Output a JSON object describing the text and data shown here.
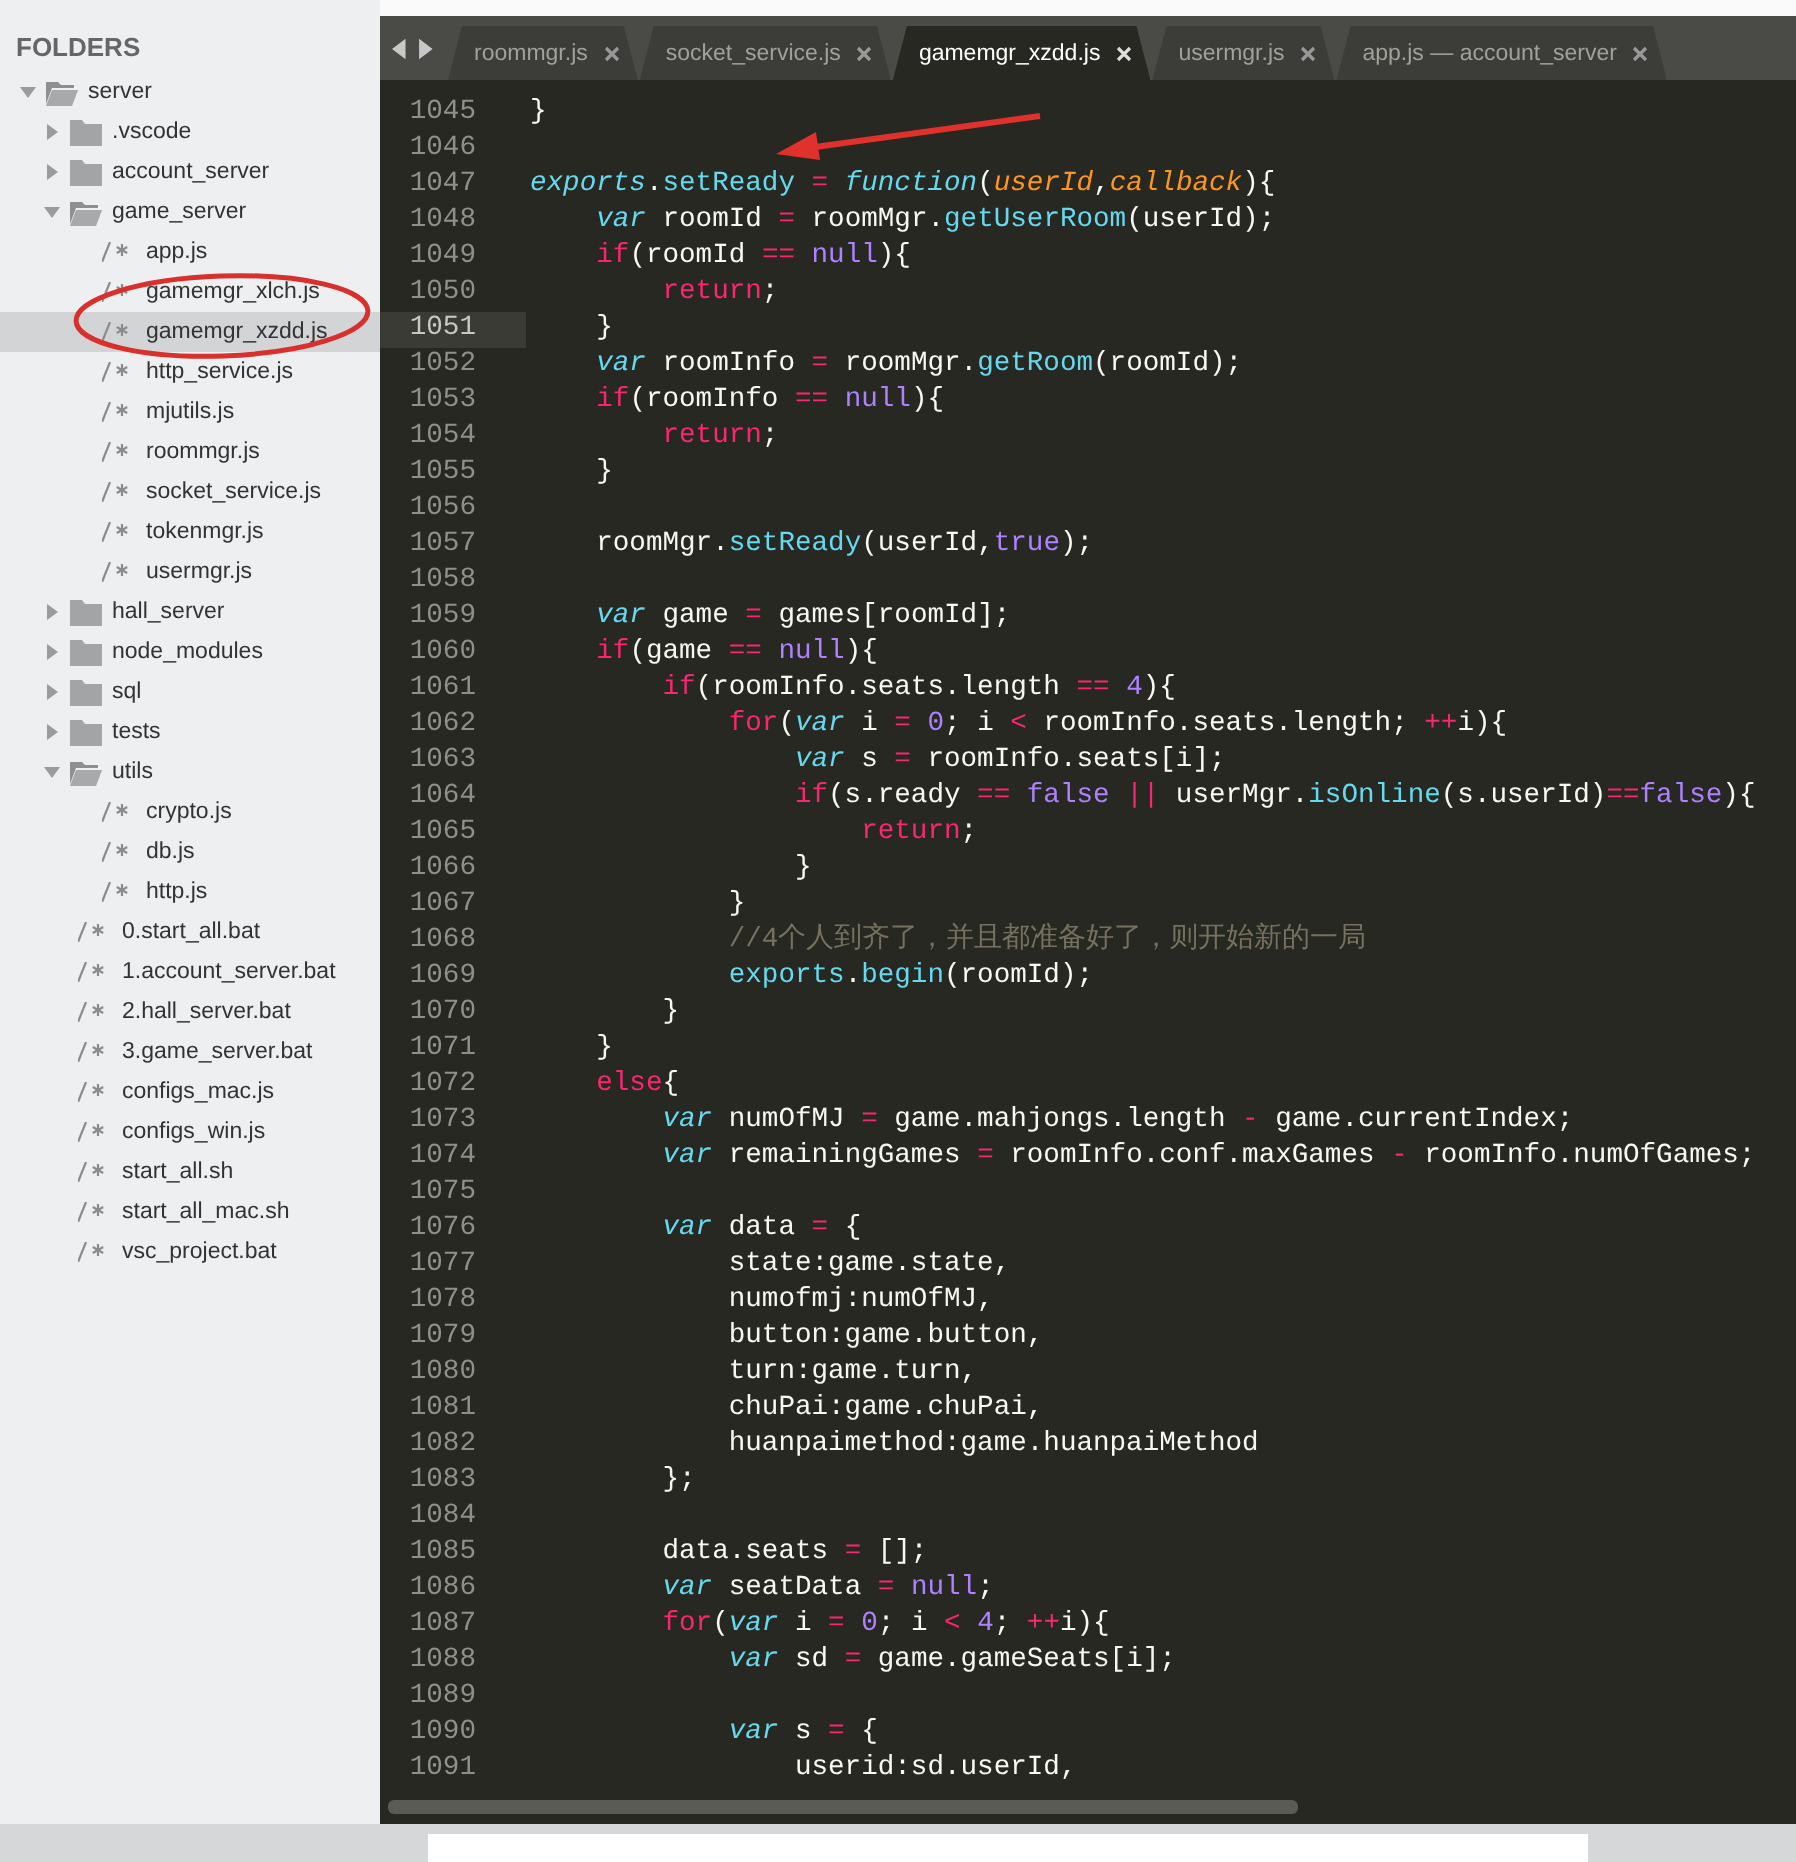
{
  "sidebar": {
    "title": "FOLDERS",
    "tree": [
      {
        "kind": "folder",
        "label": "server",
        "expanded": true,
        "selected": false,
        "children": [
          {
            "kind": "folder",
            "label": ".vscode",
            "expanded": false,
            "selected": false
          },
          {
            "kind": "folder",
            "label": "account_server",
            "expanded": false,
            "selected": false
          },
          {
            "kind": "folder",
            "label": "game_server",
            "expanded": true,
            "selected": false,
            "children": [
              {
                "kind": "file",
                "label": "app.js",
                "selected": false
              },
              {
                "kind": "file",
                "label": "gamemgr_xlch.js",
                "selected": false
              },
              {
                "kind": "file",
                "label": "gamemgr_xzdd.js",
                "selected": true
              },
              {
                "kind": "file",
                "label": "http_service.js",
                "selected": false
              },
              {
                "kind": "file",
                "label": "mjutils.js",
                "selected": false
              },
              {
                "kind": "file",
                "label": "roommgr.js",
                "selected": false
              },
              {
                "kind": "file",
                "label": "socket_service.js",
                "selected": false
              },
              {
                "kind": "file",
                "label": "tokenmgr.js",
                "selected": false
              },
              {
                "kind": "file",
                "label": "usermgr.js",
                "selected": false
              }
            ]
          },
          {
            "kind": "folder",
            "label": "hall_server",
            "expanded": false,
            "selected": false
          },
          {
            "kind": "folder",
            "label": "node_modules",
            "expanded": false,
            "selected": false
          },
          {
            "kind": "folder",
            "label": "sql",
            "expanded": false,
            "selected": false
          },
          {
            "kind": "folder",
            "label": "tests",
            "expanded": false,
            "selected": false
          },
          {
            "kind": "folder",
            "label": "utils",
            "expanded": true,
            "selected": false,
            "children": [
              {
                "kind": "file",
                "label": "crypto.js",
                "selected": false
              },
              {
                "kind": "file",
                "label": "db.js",
                "selected": false
              },
              {
                "kind": "file",
                "label": "http.js",
                "selected": false
              }
            ]
          },
          {
            "kind": "file",
            "label": "0.start_all.bat",
            "selected": false
          },
          {
            "kind": "file",
            "label": "1.account_server.bat",
            "selected": false
          },
          {
            "kind": "file",
            "label": "2.hall_server.bat",
            "selected": false
          },
          {
            "kind": "file",
            "label": "3.game_server.bat",
            "selected": false
          },
          {
            "kind": "file",
            "label": "configs_mac.js",
            "selected": false
          },
          {
            "kind": "file",
            "label": "configs_win.js",
            "selected": false
          },
          {
            "kind": "file",
            "label": "start_all.sh",
            "selected": false
          },
          {
            "kind": "file",
            "label": "start_all_mac.sh",
            "selected": false
          },
          {
            "kind": "file",
            "label": "vsc_project.bat",
            "selected": false
          }
        ]
      }
    ]
  },
  "tabs": [
    {
      "label": "roommgr.js",
      "selected": false
    },
    {
      "label": "socket_service.js",
      "selected": false
    },
    {
      "label": "gamemgr_xzdd.js",
      "selected": true
    },
    {
      "label": "usermgr.js",
      "selected": false
    },
    {
      "label": "app.js — account_server",
      "selected": false
    }
  ],
  "editor": {
    "lines": [
      {
        "number": "1045",
        "current": false,
        "tokens": [
          {
            "kind": "plain",
            "text": "}"
          }
        ]
      },
      {
        "number": "1046",
        "current": false
      },
      {
        "number": "1047",
        "current": false,
        "tokens": [
          {
            "kind": "storage",
            "text": "exports"
          },
          {
            "kind": "plain",
            "text": "."
          },
          {
            "kind": "function",
            "text": "setReady"
          },
          {
            "kind": "keyword",
            "text": " = "
          },
          {
            "kind": "storage",
            "text": "function"
          },
          {
            "kind": "plain",
            "text": "("
          },
          {
            "kind": "param",
            "text": "userId"
          },
          {
            "kind": "plain",
            "text": ","
          },
          {
            "kind": "param",
            "text": "callback"
          },
          {
            "kind": "plain",
            "text": "){"
          }
        ]
      },
      {
        "number": "1048",
        "current": false,
        "tokens": [
          {
            "kind": "storage",
            "text": "    var"
          },
          {
            "kind": "plain",
            "text": " roomId "
          },
          {
            "kind": "keyword",
            "text": "="
          },
          {
            "kind": "plain",
            "text": " roomMgr."
          },
          {
            "kind": "function",
            "text": "getUserRoom"
          },
          {
            "kind": "plain",
            "text": "(userId);"
          }
        ]
      },
      {
        "number": "1049",
        "current": false,
        "tokens": [
          {
            "kind": "keyword",
            "text": "    if"
          },
          {
            "kind": "plain",
            "text": "(roomId "
          },
          {
            "kind": "keyword",
            "text": "== "
          },
          {
            "kind": "constant",
            "text": "null"
          },
          {
            "kind": "plain",
            "text": "){"
          }
        ]
      },
      {
        "number": "1050",
        "current": false,
        "tokens": [
          {
            "kind": "keyword",
            "text": "        return"
          },
          {
            "kind": "plain",
            "text": ";"
          }
        ]
      },
      {
        "number": "1051",
        "current": true,
        "tokens": [
          {
            "kind": "plain",
            "text": "    }"
          }
        ]
      },
      {
        "number": "1052",
        "current": false,
        "tokens": [
          {
            "kind": "storage",
            "text": "    var"
          },
          {
            "kind": "plain",
            "text": " roomInfo "
          },
          {
            "kind": "keyword",
            "text": "="
          },
          {
            "kind": "plain",
            "text": " roomMgr."
          },
          {
            "kind": "function",
            "text": "getRoom"
          },
          {
            "kind": "plain",
            "text": "(roomId);"
          }
        ]
      },
      {
        "number": "1053",
        "current": false,
        "tokens": [
          {
            "kind": "keyword",
            "text": "    if"
          },
          {
            "kind": "plain",
            "text": "(roomInfo "
          },
          {
            "kind": "keyword",
            "text": "== "
          },
          {
            "kind": "constant",
            "text": "null"
          },
          {
            "kind": "plain",
            "text": "){"
          }
        ]
      },
      {
        "number": "1054",
        "current": false,
        "tokens": [
          {
            "kind": "keyword",
            "text": "        return"
          },
          {
            "kind": "plain",
            "text": ";"
          }
        ]
      },
      {
        "number": "1055",
        "current": false,
        "tokens": [
          {
            "kind": "plain",
            "text": "    }"
          }
        ]
      },
      {
        "number": "1056",
        "current": false
      },
      {
        "number": "1057",
        "current": false,
        "tokens": [
          {
            "kind": "plain",
            "text": "    roomMgr."
          },
          {
            "kind": "function",
            "text": "setReady"
          },
          {
            "kind": "plain",
            "text": "(userId,"
          },
          {
            "kind": "constant",
            "text": "true"
          },
          {
            "kind": "plain",
            "text": ");"
          }
        ]
      },
      {
        "number": "1058",
        "current": false
      },
      {
        "number": "1059",
        "current": false,
        "tokens": [
          {
            "kind": "storage",
            "text": "    var"
          },
          {
            "kind": "plain",
            "text": " game "
          },
          {
            "kind": "keyword",
            "text": "="
          },
          {
            "kind": "plain",
            "text": " games[roomId];"
          }
        ]
      },
      {
        "number": "1060",
        "current": false,
        "tokens": [
          {
            "kind": "keyword",
            "text": "    if"
          },
          {
            "kind": "plain",
            "text": "(game "
          },
          {
            "kind": "keyword",
            "text": "== "
          },
          {
            "kind": "constant",
            "text": "null"
          },
          {
            "kind": "plain",
            "text": "){"
          }
        ]
      },
      {
        "number": "1061",
        "current": false,
        "tokens": [
          {
            "kind": "keyword",
            "text": "        if"
          },
          {
            "kind": "plain",
            "text": "(roomInfo.seats.length "
          },
          {
            "kind": "keyword",
            "text": "== "
          },
          {
            "kind": "constant",
            "text": "4"
          },
          {
            "kind": "plain",
            "text": "){"
          }
        ]
      },
      {
        "number": "1062",
        "current": false,
        "tokens": [
          {
            "kind": "keyword",
            "text": "            for"
          },
          {
            "kind": "plain",
            "text": "("
          },
          {
            "kind": "storage",
            "text": "var"
          },
          {
            "kind": "plain",
            "text": " i "
          },
          {
            "kind": "keyword",
            "text": "= "
          },
          {
            "kind": "constant",
            "text": "0"
          },
          {
            "kind": "plain",
            "text": "; i "
          },
          {
            "kind": "keyword",
            "text": "<"
          },
          {
            "kind": "plain",
            "text": " roomInfo.seats.length; "
          },
          {
            "kind": "keyword",
            "text": "++"
          },
          {
            "kind": "plain",
            "text": "i){"
          }
        ]
      },
      {
        "number": "1063",
        "current": false,
        "tokens": [
          {
            "kind": "storage",
            "text": "                var"
          },
          {
            "kind": "plain",
            "text": " s "
          },
          {
            "kind": "keyword",
            "text": "="
          },
          {
            "kind": "plain",
            "text": " roomInfo.seats[i];"
          }
        ]
      },
      {
        "number": "1064",
        "current": false,
        "tokens": [
          {
            "kind": "keyword",
            "text": "                if"
          },
          {
            "kind": "plain",
            "text": "(s.ready "
          },
          {
            "kind": "keyword",
            "text": "== "
          },
          {
            "kind": "constant",
            "text": "false"
          },
          {
            "kind": "keyword",
            "text": " ||"
          },
          {
            "kind": "plain",
            "text": " userMgr."
          },
          {
            "kind": "function",
            "text": "isOnline"
          },
          {
            "kind": "plain",
            "text": "(s.userId)"
          },
          {
            "kind": "keyword",
            "text": "=="
          },
          {
            "kind": "constant",
            "text": "false"
          },
          {
            "kind": "plain",
            "text": "){"
          }
        ]
      },
      {
        "number": "1065",
        "current": false,
        "tokens": [
          {
            "kind": "keyword",
            "text": "                    return"
          },
          {
            "kind": "plain",
            "text": ";"
          }
        ]
      },
      {
        "number": "1066",
        "current": false,
        "tokens": [
          {
            "kind": "plain",
            "text": "                }"
          }
        ]
      },
      {
        "number": "1067",
        "current": false,
        "tokens": [
          {
            "kind": "plain",
            "text": "            }"
          }
        ]
      },
      {
        "number": "1068",
        "current": false,
        "tokens": [
          {
            "kind": "comment",
            "text": "            //4个人到齐了，并且都准备好了，则开始新的一局"
          }
        ]
      },
      {
        "number": "1069",
        "current": false,
        "tokens": [
          {
            "kind": "function",
            "text": "            exports"
          },
          {
            "kind": "plain",
            "text": "."
          },
          {
            "kind": "function",
            "text": "begin"
          },
          {
            "kind": "plain",
            "text": "(roomId);"
          }
        ]
      },
      {
        "number": "1070",
        "current": false,
        "tokens": [
          {
            "kind": "plain",
            "text": "        }"
          }
        ]
      },
      {
        "number": "1071",
        "current": false,
        "tokens": [
          {
            "kind": "plain",
            "text": "    }"
          }
        ]
      },
      {
        "number": "1072",
        "current": false,
        "tokens": [
          {
            "kind": "keyword",
            "text": "    else"
          },
          {
            "kind": "plain",
            "text": "{"
          }
        ]
      },
      {
        "number": "1073",
        "current": false,
        "tokens": [
          {
            "kind": "storage",
            "text": "        var"
          },
          {
            "kind": "plain",
            "text": " numOfMJ "
          },
          {
            "kind": "keyword",
            "text": "="
          },
          {
            "kind": "plain",
            "text": " game.mahjongs.length "
          },
          {
            "kind": "keyword",
            "text": "-"
          },
          {
            "kind": "plain",
            "text": " game.currentIndex;"
          }
        ]
      },
      {
        "number": "1074",
        "current": false,
        "tokens": [
          {
            "kind": "storage",
            "text": "        var"
          },
          {
            "kind": "plain",
            "text": " remainingGames "
          },
          {
            "kind": "keyword",
            "text": "="
          },
          {
            "kind": "plain",
            "text": " roomInfo.conf.maxGames "
          },
          {
            "kind": "keyword",
            "text": "-"
          },
          {
            "kind": "plain",
            "text": " roomInfo.numOfGames;"
          }
        ]
      },
      {
        "number": "1075",
        "current": false
      },
      {
        "number": "1076",
        "current": false,
        "tokens": [
          {
            "kind": "storage",
            "text": "        var"
          },
          {
            "kind": "plain",
            "text": " data "
          },
          {
            "kind": "keyword",
            "text": "="
          },
          {
            "kind": "plain",
            "text": " {"
          }
        ]
      },
      {
        "number": "1077",
        "current": false,
        "tokens": [
          {
            "kind": "plain",
            "text": "            state:game.state,"
          }
        ]
      },
      {
        "number": "1078",
        "current": false,
        "tokens": [
          {
            "kind": "plain",
            "text": "            numofmj:numOfMJ,"
          }
        ]
      },
      {
        "number": "1079",
        "current": false,
        "tokens": [
          {
            "kind": "plain",
            "text": "            button:game.button,"
          }
        ]
      },
      {
        "number": "1080",
        "current": false,
        "tokens": [
          {
            "kind": "plain",
            "text": "            turn:game.turn,"
          }
        ]
      },
      {
        "number": "1081",
        "current": false,
        "tokens": [
          {
            "kind": "plain",
            "text": "            chuPai:game.chuPai,"
          }
        ]
      },
      {
        "number": "1082",
        "current": false,
        "tokens": [
          {
            "kind": "plain",
            "text": "            huanpaimethod:game.huanpaiMethod"
          }
        ]
      },
      {
        "number": "1083",
        "current": false,
        "tokens": [
          {
            "kind": "plain",
            "text": "        };"
          }
        ]
      },
      {
        "number": "1084",
        "current": false
      },
      {
        "number": "1085",
        "current": false,
        "tokens": [
          {
            "kind": "plain",
            "text": "        data.seats "
          },
          {
            "kind": "keyword",
            "text": "="
          },
          {
            "kind": "plain",
            "text": " [];"
          }
        ]
      },
      {
        "number": "1086",
        "current": false,
        "tokens": [
          {
            "kind": "storage",
            "text": "        var"
          },
          {
            "kind": "plain",
            "text": " seatData "
          },
          {
            "kind": "keyword",
            "text": "= "
          },
          {
            "kind": "constant",
            "text": "null"
          },
          {
            "kind": "plain",
            "text": ";"
          }
        ]
      },
      {
        "number": "1087",
        "current": false,
        "tokens": [
          {
            "kind": "keyword",
            "text": "        for"
          },
          {
            "kind": "plain",
            "text": "("
          },
          {
            "kind": "storage",
            "text": "var"
          },
          {
            "kind": "plain",
            "text": " i "
          },
          {
            "kind": "keyword",
            "text": "= "
          },
          {
            "kind": "constant",
            "text": "0"
          },
          {
            "kind": "plain",
            "text": "; i "
          },
          {
            "kind": "keyword",
            "text": "< "
          },
          {
            "kind": "constant",
            "text": "4"
          },
          {
            "kind": "plain",
            "text": "; "
          },
          {
            "kind": "keyword",
            "text": "++"
          },
          {
            "kind": "plain",
            "text": "i){"
          }
        ]
      },
      {
        "number": "1088",
        "current": false,
        "tokens": [
          {
            "kind": "storage",
            "text": "            var"
          },
          {
            "kind": "plain",
            "text": " sd "
          },
          {
            "kind": "keyword",
            "text": "="
          },
          {
            "kind": "plain",
            "text": " game.gameSeats[i];"
          }
        ]
      },
      {
        "number": "1089",
        "current": false
      },
      {
        "number": "1090",
        "current": false,
        "tokens": [
          {
            "kind": "storage",
            "text": "            var"
          },
          {
            "kind": "plain",
            "text": " s "
          },
          {
            "kind": "keyword",
            "text": "="
          },
          {
            "kind": "plain",
            "text": " {"
          }
        ]
      },
      {
        "number": "1091",
        "current": false,
        "tokens": [
          {
            "kind": "plain",
            "text": "                userid:sd.userId,"
          }
        ]
      }
    ]
  },
  "annotations": [
    {
      "kind": "ellipse"
    },
    {
      "kind": "arrow"
    }
  ]
}
